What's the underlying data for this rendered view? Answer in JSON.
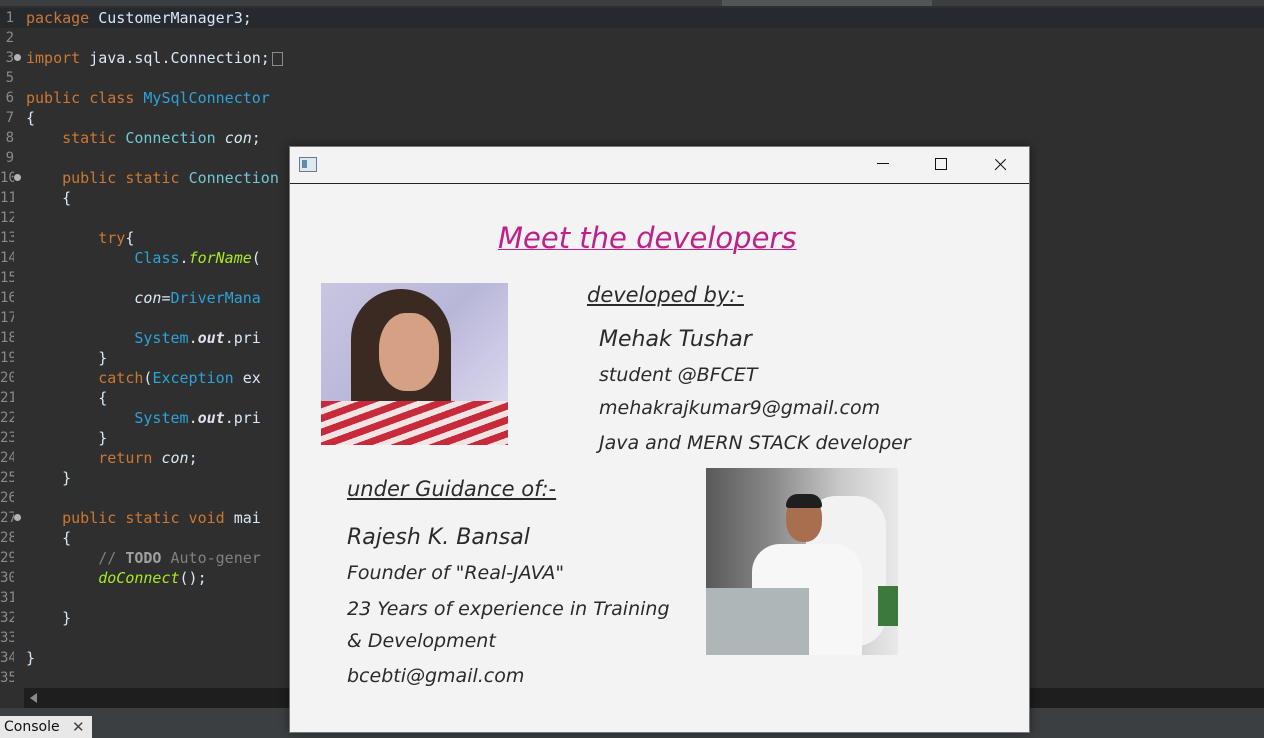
{
  "editor": {
    "lines": [
      {
        "n": "1",
        "fold": false,
        "tokens": [
          [
            "kw",
            "package "
          ],
          [
            "",
            "CustomerManager3;"
          ]
        ]
      },
      {
        "n": "2",
        "fold": false,
        "tokens": []
      },
      {
        "n": "3",
        "fold": true,
        "tokens": [
          [
            "kw",
            "import "
          ],
          [
            "",
            "java.sql.Connection;"
          ]
        ],
        "folded": true
      },
      {
        "n": "5",
        "fold": false,
        "tokens": []
      },
      {
        "n": "6",
        "fold": false,
        "tokens": [
          [
            "kw",
            "public class "
          ],
          [
            "cls",
            "MySqlConnector"
          ]
        ]
      },
      {
        "n": "7",
        "fold": false,
        "tokens": [
          [
            "",
            "{"
          ]
        ]
      },
      {
        "n": "8",
        "fold": false,
        "tokens": [
          [
            "",
            "    "
          ],
          [
            "kw",
            "static "
          ],
          [
            "ty",
            "Connection "
          ],
          [
            "fld",
            "con"
          ],
          [
            "",
            ";"
          ]
        ]
      },
      {
        "n": "9",
        "fold": false,
        "tokens": []
      },
      {
        "n": "10",
        "fold": true,
        "tokens": [
          [
            "",
            "    "
          ],
          [
            "kw",
            "public static "
          ],
          [
            "ty",
            "Connection"
          ]
        ]
      },
      {
        "n": "11",
        "fold": false,
        "tokens": [
          [
            "",
            "    {"
          ]
        ]
      },
      {
        "n": "12",
        "fold": false,
        "tokens": []
      },
      {
        "n": "13",
        "fold": false,
        "tokens": [
          [
            "",
            "        "
          ],
          [
            "kw",
            "try"
          ],
          [
            "",
            "{"
          ]
        ]
      },
      {
        "n": "14",
        "fold": false,
        "tokens": [
          [
            "",
            "            "
          ],
          [
            "cls",
            "Class"
          ],
          [
            "",
            "."
          ],
          [
            "mth",
            "forName"
          ],
          [
            "",
            "("
          ]
        ]
      },
      {
        "n": "15",
        "fold": false,
        "tokens": []
      },
      {
        "n": "16",
        "fold": false,
        "tokens": [
          [
            "",
            "            "
          ],
          [
            "fld",
            "con"
          ],
          [
            "",
            "="
          ],
          [
            "cls",
            "DriverMana"
          ]
        ]
      },
      {
        "n": "17",
        "fold": false,
        "tokens": []
      },
      {
        "n": "18",
        "fold": false,
        "tokens": [
          [
            "",
            "            "
          ],
          [
            "cls",
            "System"
          ],
          [
            "",
            "."
          ],
          [
            "sfld",
            "out"
          ],
          [
            "",
            "."
          ],
          [
            "",
            "pri"
          ]
        ]
      },
      {
        "n": "19",
        "fold": false,
        "tokens": [
          [
            "",
            "        }"
          ]
        ]
      },
      {
        "n": "20",
        "fold": false,
        "tokens": [
          [
            "",
            "        "
          ],
          [
            "kw",
            "catch"
          ],
          [
            "",
            "("
          ],
          [
            "cls",
            "Exception "
          ],
          [
            "",
            "ex"
          ]
        ]
      },
      {
        "n": "21",
        "fold": false,
        "tokens": [
          [
            "",
            "        {"
          ]
        ]
      },
      {
        "n": "22",
        "fold": false,
        "tokens": [
          [
            "",
            "            "
          ],
          [
            "cls",
            "System"
          ],
          [
            "",
            "."
          ],
          [
            "sfld",
            "out"
          ],
          [
            "",
            "."
          ],
          [
            "",
            "pri"
          ]
        ]
      },
      {
        "n": "23",
        "fold": false,
        "tokens": [
          [
            "",
            "        }"
          ]
        ]
      },
      {
        "n": "24",
        "fold": false,
        "tokens": [
          [
            "",
            "        "
          ],
          [
            "kw",
            "return "
          ],
          [
            "fld",
            "con"
          ],
          [
            "",
            ";"
          ]
        ]
      },
      {
        "n": "25",
        "fold": false,
        "tokens": [
          [
            "",
            "    }"
          ]
        ]
      },
      {
        "n": "26",
        "fold": false,
        "tokens": []
      },
      {
        "n": "27",
        "fold": true,
        "tokens": [
          [
            "",
            "    "
          ],
          [
            "kw",
            "public static void "
          ],
          [
            "",
            "mai"
          ]
        ]
      },
      {
        "n": "28",
        "fold": false,
        "tokens": [
          [
            "",
            "    {"
          ]
        ]
      },
      {
        "n": "29",
        "fold": false,
        "tokens": [
          [
            "",
            "        "
          ],
          [
            "cmt",
            "// "
          ],
          [
            "todo",
            "TODO"
          ],
          [
            "cmt",
            " Auto-gener"
          ]
        ]
      },
      {
        "n": "30",
        "fold": false,
        "tokens": [
          [
            "",
            "        "
          ],
          [
            "mth",
            "doConnect"
          ],
          [
            "",
            "();"
          ]
        ]
      },
      {
        "n": "31",
        "fold": false,
        "tokens": []
      },
      {
        "n": "32",
        "fold": false,
        "tokens": [
          [
            "",
            "    }"
          ]
        ]
      },
      {
        "n": "33",
        "fold": false,
        "tokens": []
      },
      {
        "n": "34",
        "fold": false,
        "tokens": [
          [
            "",
            "}"
          ]
        ]
      },
      {
        "n": "35",
        "fold": false,
        "tokens": []
      }
    ]
  },
  "console": {
    "label": "Console",
    "close": "✕"
  },
  "dialog": {
    "heading": "Meet the developers",
    "developed_by": " developed by:-",
    "developer": {
      "name": "Mehak Tushar",
      "role": "student @BFCET",
      "email": "mehakrajkumar9@gmail.com",
      "skills": "Java and MERN STACK developer"
    },
    "guidance_label": "under Guidance of:-",
    "mentor": {
      "name": "Rajesh K. Bansal",
      "title": "Founder of \"Real-JAVA\"",
      "experience_1": "23 Years of experience in Training",
      "experience_2": " & Development",
      "email": "bcebti@gmail.com"
    }
  },
  "colors": {
    "heading": "#c0208a",
    "editor_bg": "#2f2f2f",
    "keyword": "#cc7832"
  }
}
